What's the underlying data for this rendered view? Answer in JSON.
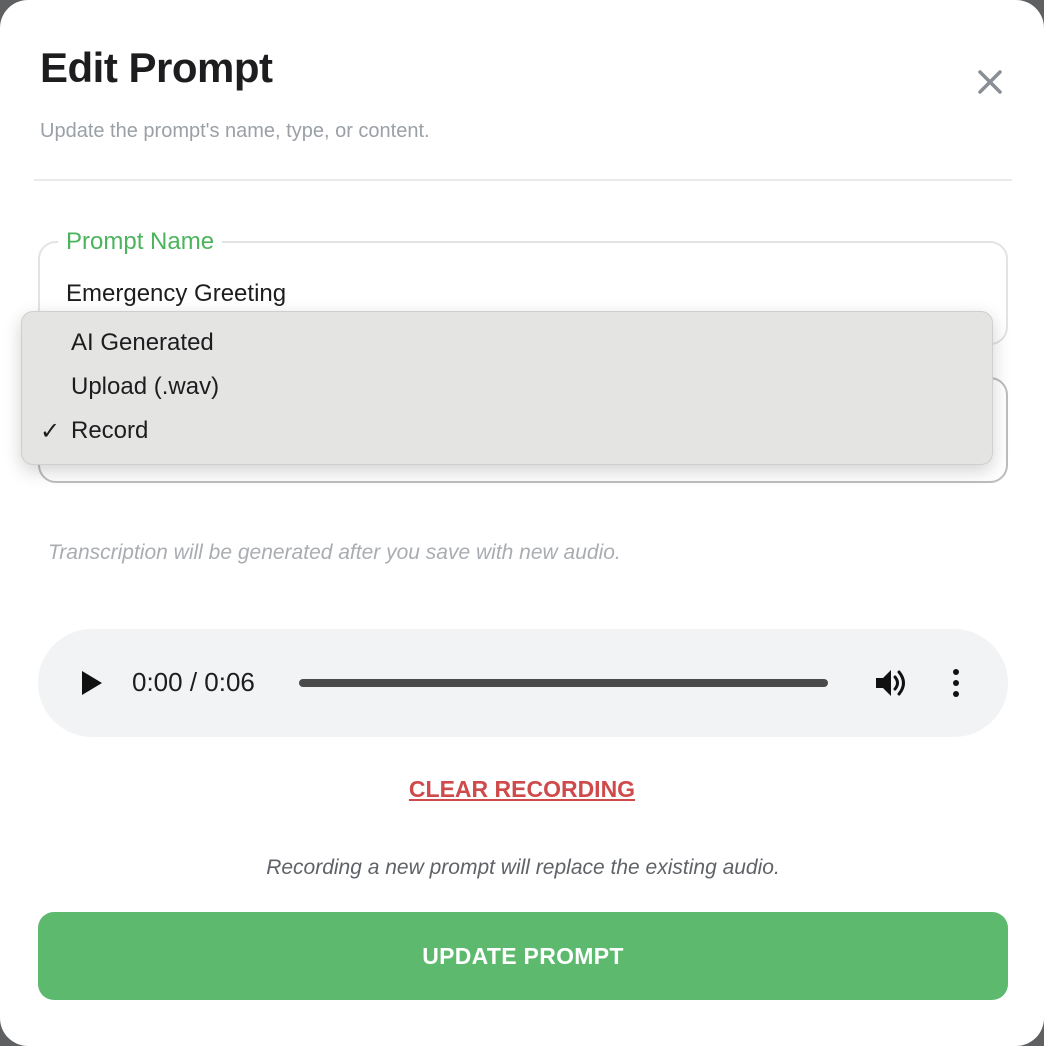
{
  "dialog": {
    "title": "Edit Prompt",
    "subtitle": "Update the prompt's name, type, or content."
  },
  "name_field": {
    "label": "Prompt Name",
    "value": "Emergency Greeting"
  },
  "type_dropdown": {
    "options": [
      {
        "label": "AI Generated",
        "selected": false
      },
      {
        "label": "Upload (.wav)",
        "selected": false
      },
      {
        "label": "Record",
        "selected": true
      }
    ],
    "check_glyph": "✓"
  },
  "hint_text": "Transcription will be generated after you save with new audio.",
  "audio_player": {
    "time_display": "0:00 / 0:06",
    "progress": 0
  },
  "clear_label": "CLEAR RECORDING",
  "note_text": "Recording a new prompt will replace the existing audio.",
  "submit_label": "UPDATE PROMPT",
  "colors": {
    "accent_green": "#5cb96d",
    "label_green": "#4cb45c",
    "danger_red": "#cf4a4a"
  },
  "icons": [
    "close-icon",
    "play-icon",
    "volume-icon",
    "more-vert-icon",
    "checkmark-icon"
  ]
}
